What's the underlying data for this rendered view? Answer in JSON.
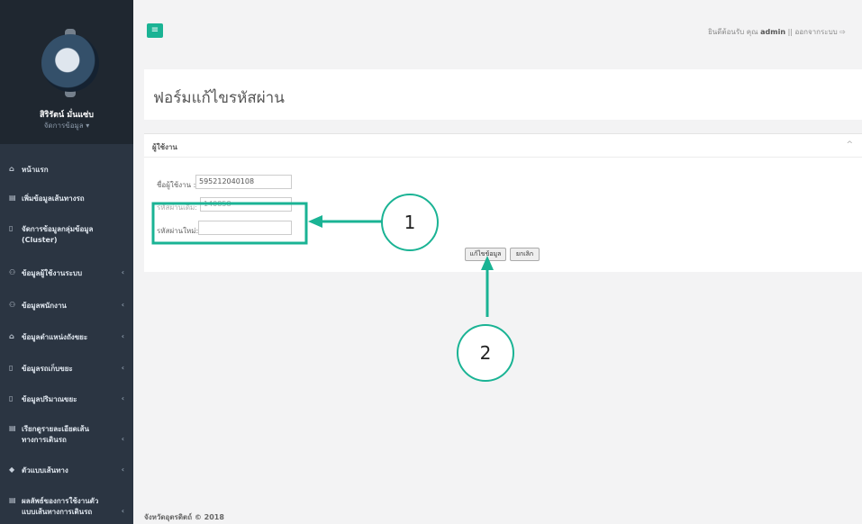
{
  "sidebar": {
    "profile_name": "สิริรัตน์ มั่นแซ่บ",
    "profile_role": "จัดการข้อมูล ▾",
    "items": [
      {
        "icon": "home-icon",
        "glyph": "⌂",
        "label": "หน้าแรก",
        "has_chevron": false
      },
      {
        "icon": "doc-icon",
        "glyph": "▤",
        "label": "เพิ่มข้อมูลเส้นทางรถ",
        "has_chevron": false
      },
      {
        "icon": "trash-icon",
        "glyph": "▯",
        "label": "จัดการข้อมูลกลุ่มข้อมูล (Cluster)",
        "has_chevron": false
      },
      {
        "icon": "users-icon",
        "glyph": "⚇",
        "label": "ข้อมูลผู้ใช้งานระบบ",
        "has_chevron": true
      },
      {
        "icon": "users-icon",
        "glyph": "⚇",
        "label": "ข้อมูลพนักงาน",
        "has_chevron": true
      },
      {
        "icon": "home-icon",
        "glyph": "⌂",
        "label": "ข้อมูลตำแหน่งถังขยะ",
        "has_chevron": true
      },
      {
        "icon": "trash-icon",
        "glyph": "▯",
        "label": "ข้อมูลรถเก็บขยะ",
        "has_chevron": true
      },
      {
        "icon": "trash-icon",
        "glyph": "▯",
        "label": "ข้อมูลปริมาณขยะ",
        "has_chevron": true
      },
      {
        "icon": "doc-icon",
        "glyph": "▤",
        "label": "เรียกดูรายละเอียดเส้นทางการเดินรถ",
        "has_chevron": true
      },
      {
        "icon": "car-icon",
        "glyph": "◆",
        "label": "ตัวแบบเส้นทาง",
        "has_chevron": true
      },
      {
        "icon": "doc-icon",
        "glyph": "▤",
        "label": "ผลลัพธ์ของการใช้งานตัวแบบเส้นทางการเดินรถ",
        "has_chevron": true
      }
    ],
    "chevron": "‹"
  },
  "topbar": {
    "toggle_glyph": "≡",
    "welcome": "ยินดีต้อนรับ คุณ",
    "username": "admin",
    "separator": "||",
    "logout": "ออกจากระบบ ⇨"
  },
  "page": {
    "title": "ฟอร์มแก้ไขรหัสผ่าน"
  },
  "panel": {
    "title": "ผู้ใช้งาน",
    "collapse_glyph": "^",
    "username_label": "ชื่อผู้ใช้งาน :",
    "username_value": "595212040108",
    "old_password_label": "รหัสผ่านเดิม:",
    "old_password_value": "140858",
    "new_password_label": "รหัสผ่านใหม่:",
    "new_password_value": "",
    "save_button": "แก้ไขข้อมูล",
    "cancel_button": "ยกเลิก"
  },
  "footer": {
    "text": "จังหวัดอุตรดิตถ์ © 2018"
  },
  "annotations": {
    "marker_1": "1",
    "marker_2": "2",
    "accent_color": "#1ab394"
  }
}
